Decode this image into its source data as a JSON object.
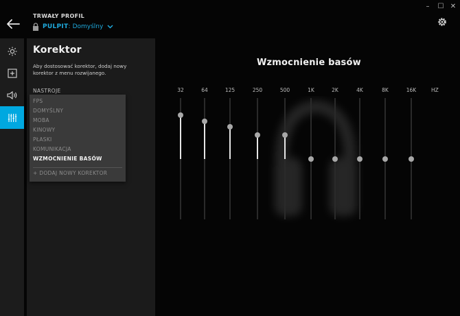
{
  "header": {
    "profile_caption": "TRWAŁY PROFIL",
    "profile_name": "PULPIT",
    "profile_sep": ":",
    "profile_value": "Domyślny",
    "back_icon": "arrow-left-icon",
    "lock_icon": "lock-icon",
    "settings_icon": "gear-icon"
  },
  "window_controls": {
    "minimize": "–",
    "maximize": "☐",
    "close": "✕"
  },
  "sidebar": {
    "items": [
      {
        "icon": "lighting-icon"
      },
      {
        "icon": "assignments-icon"
      },
      {
        "icon": "speaker-icon"
      },
      {
        "icon": "equalizer-icon",
        "active": true
      }
    ]
  },
  "panel": {
    "title": "Korektor",
    "description": "Aby dostosować korektor, dodaj nowy korektor z menu rozwijanego.",
    "presets_label": "NASTROJE",
    "presets": [
      "FPS",
      "DOMYŚLNY",
      "MOBA",
      "KINOWY",
      "PŁASKI",
      "KOMUNIKACJA",
      "WZMOCNIENIE BASÓW"
    ],
    "selected_preset": "WZMOCNIENIE BASÓW",
    "add_preset": "+ DODAJ NOWY KOREKTOR"
  },
  "equalizer": {
    "title": "Wzmocnienie basów",
    "unit": "HZ",
    "bands": [
      {
        "label": "32",
        "level": 0.72
      },
      {
        "label": "64",
        "level": 0.62
      },
      {
        "label": "125",
        "level": 0.53
      },
      {
        "label": "250",
        "level": 0.39
      },
      {
        "label": "500",
        "level": 0.39
      },
      {
        "label": "1K",
        "level": 0.0
      },
      {
        "label": "2K",
        "level": 0.0
      },
      {
        "label": "4K",
        "level": 0.0
      },
      {
        "label": "8K",
        "level": 0.0
      },
      {
        "label": "16K",
        "level": 0.0
      }
    ],
    "colors": {
      "accent": "#00a8e0",
      "fill": "#e6e6e6",
      "knob": "#a8a8a8"
    }
  }
}
